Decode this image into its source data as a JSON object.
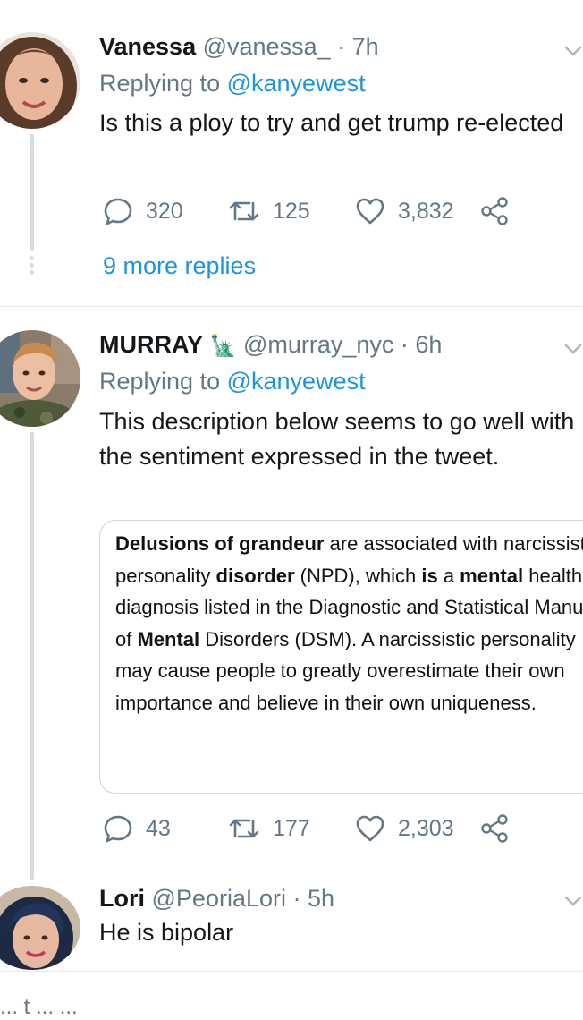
{
  "tweets": [
    {
      "name": "Vanessa",
      "handle": "@vanessa_",
      "time": "· 7h",
      "replying_prefix": "Replying to",
      "replying_to": "@kanyewest",
      "text": "Is this a ploy to try and get trump re-elected",
      "replies": "320",
      "retweets": "125",
      "likes": "3,832",
      "more_replies": "9 more replies"
    },
    {
      "name": "MURRAY",
      "name_emoji": "🗽",
      "handle": "@murray_nyc",
      "time": "· 6h",
      "replying_prefix": "Replying to",
      "replying_to": "@kanyewest",
      "text": "This description below seems to go well with the sentiment expressed in the tweet.",
      "card": {
        "p1_b": "Delusions of grandeur",
        "p2": " are associated with narcissistic personality ",
        "p3_b": "disorder",
        "p4": " (NPD), which ",
        "p5_b": "is",
        "p6": " a ",
        "p7_b": "mental",
        "p8": " health diagnosis listed in the Diagnostic and Statistical Manual of ",
        "p9_b": "Mental",
        "p10": " Disorders (DSM). A narcissistic personality may cause people to greatly overestimate their own importance and believe in their own uniqueness."
      },
      "replies": "43",
      "retweets": "177",
      "likes": "2,303"
    },
    {
      "name": "Lori",
      "handle": "@PeoriaLori",
      "time": "· 5h",
      "text": "He is bipolar"
    }
  ],
  "footer_partial": "... t ... ..."
}
